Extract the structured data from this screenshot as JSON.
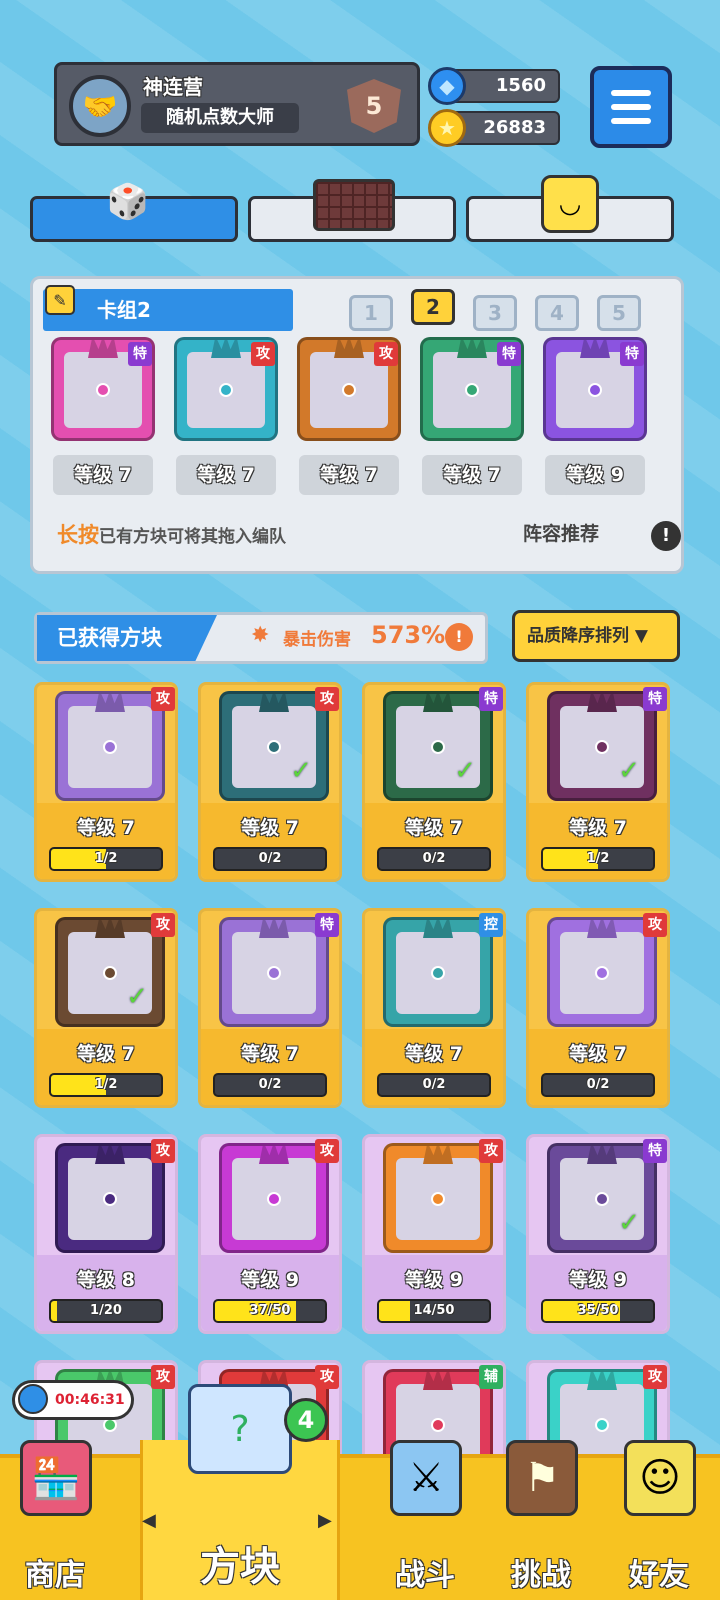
{
  "header": {
    "player_name": "神连营",
    "title": "随机点数大师",
    "rank": "5",
    "gems": "1560",
    "gold": "26883"
  },
  "tabs": [
    {
      "name": "dice-tab",
      "active": true
    },
    {
      "name": "board-tab",
      "active": false
    },
    {
      "name": "emoji-tab",
      "active": false
    }
  ],
  "deck": {
    "title": "卡组2",
    "numbers": [
      "1",
      "2",
      "3",
      "4",
      "5"
    ],
    "selected": "2",
    "slots": [
      {
        "tag": "特",
        "level": "等级 7",
        "color": "#e44fb0"
      },
      {
        "tag": "攻",
        "level": "等级 7",
        "color": "#34b3c8"
      },
      {
        "tag": "攻",
        "level": "等级 7",
        "color": "#d2792a"
      },
      {
        "tag": "特",
        "level": "等级 7",
        "color": "#35a775"
      },
      {
        "tag": "特",
        "level": "等级 9",
        "color": "#8b54e0"
      }
    ],
    "hint_bold": "长按",
    "hint_rest": "已有方块可将其拖入编队",
    "recommend": "阵容推荐",
    "info": "!"
  },
  "acquired": {
    "title": "已获得方块",
    "crit_label": "暴击伤害",
    "crit_value": "573%",
    "sort_label": "品质降序排列 ▼"
  },
  "cards": [
    {
      "tag": "攻",
      "level": "等级 7",
      "progress": "1/2",
      "fill": 0.5,
      "style": "gold",
      "color": "#9a72d6",
      "checked": false
    },
    {
      "tag": "攻",
      "level": "等级 7",
      "progress": "0/2",
      "fill": 0,
      "style": "gold",
      "color": "#2d6e78",
      "checked": true
    },
    {
      "tag": "特",
      "level": "等级 7",
      "progress": "0/2",
      "fill": 0,
      "style": "gold",
      "color": "#2c6a48",
      "checked": true
    },
    {
      "tag": "特",
      "level": "等级 7",
      "progress": "1/2",
      "fill": 0.5,
      "style": "gold",
      "color": "#6f3060",
      "checked": true
    },
    {
      "tag": "攻",
      "level": "等级 7",
      "progress": "1/2",
      "fill": 0.5,
      "style": "gold",
      "color": "#6b4a32",
      "checked": true
    },
    {
      "tag": "特",
      "level": "等级 7",
      "progress": "0/2",
      "fill": 0,
      "style": "gold",
      "color": "#9a72d6",
      "checked": false
    },
    {
      "tag": "控",
      "level": "等级 7",
      "progress": "0/2",
      "fill": 0,
      "style": "gold",
      "color": "#36a4a8",
      "checked": false
    },
    {
      "tag": "攻",
      "level": "等级 7",
      "progress": "0/2",
      "fill": 0,
      "style": "gold",
      "color": "#a070e0",
      "checked": false
    },
    {
      "tag": "攻",
      "level": "等级 8",
      "progress": "1/20",
      "fill": 0.05,
      "style": "purple",
      "color": "#4a2a80",
      "checked": false
    },
    {
      "tag": "攻",
      "level": "等级 9",
      "progress": "37/50",
      "fill": 0.74,
      "style": "purple",
      "color": "#c73ad4",
      "checked": false
    },
    {
      "tag": "攻",
      "level": "等级 9",
      "progress": "14/50",
      "fill": 0.28,
      "style": "purple",
      "color": "#f08a2a",
      "checked": false
    },
    {
      "tag": "特",
      "level": "等级 9",
      "progress": "35/50",
      "fill": 0.7,
      "style": "purple",
      "color": "#6a4a9a",
      "checked": true
    },
    {
      "tag": "攻",
      "style": "purple",
      "color": "#4ac86a"
    },
    {
      "tag": "攻",
      "style": "purple",
      "color": "#e03a3a"
    },
    {
      "tag": "辅",
      "style": "purple",
      "color": "#e03a5a"
    },
    {
      "tag": "攻",
      "style": "purple",
      "color": "#3ad2c8"
    }
  ],
  "nav": {
    "shop": "商店",
    "dice": "方块",
    "battle": "战斗",
    "challenge": "挑战",
    "friends": "好友",
    "timer": "00:46:31",
    "badge": "4",
    "left_arrow": "◀",
    "right_arrow": "▶"
  }
}
